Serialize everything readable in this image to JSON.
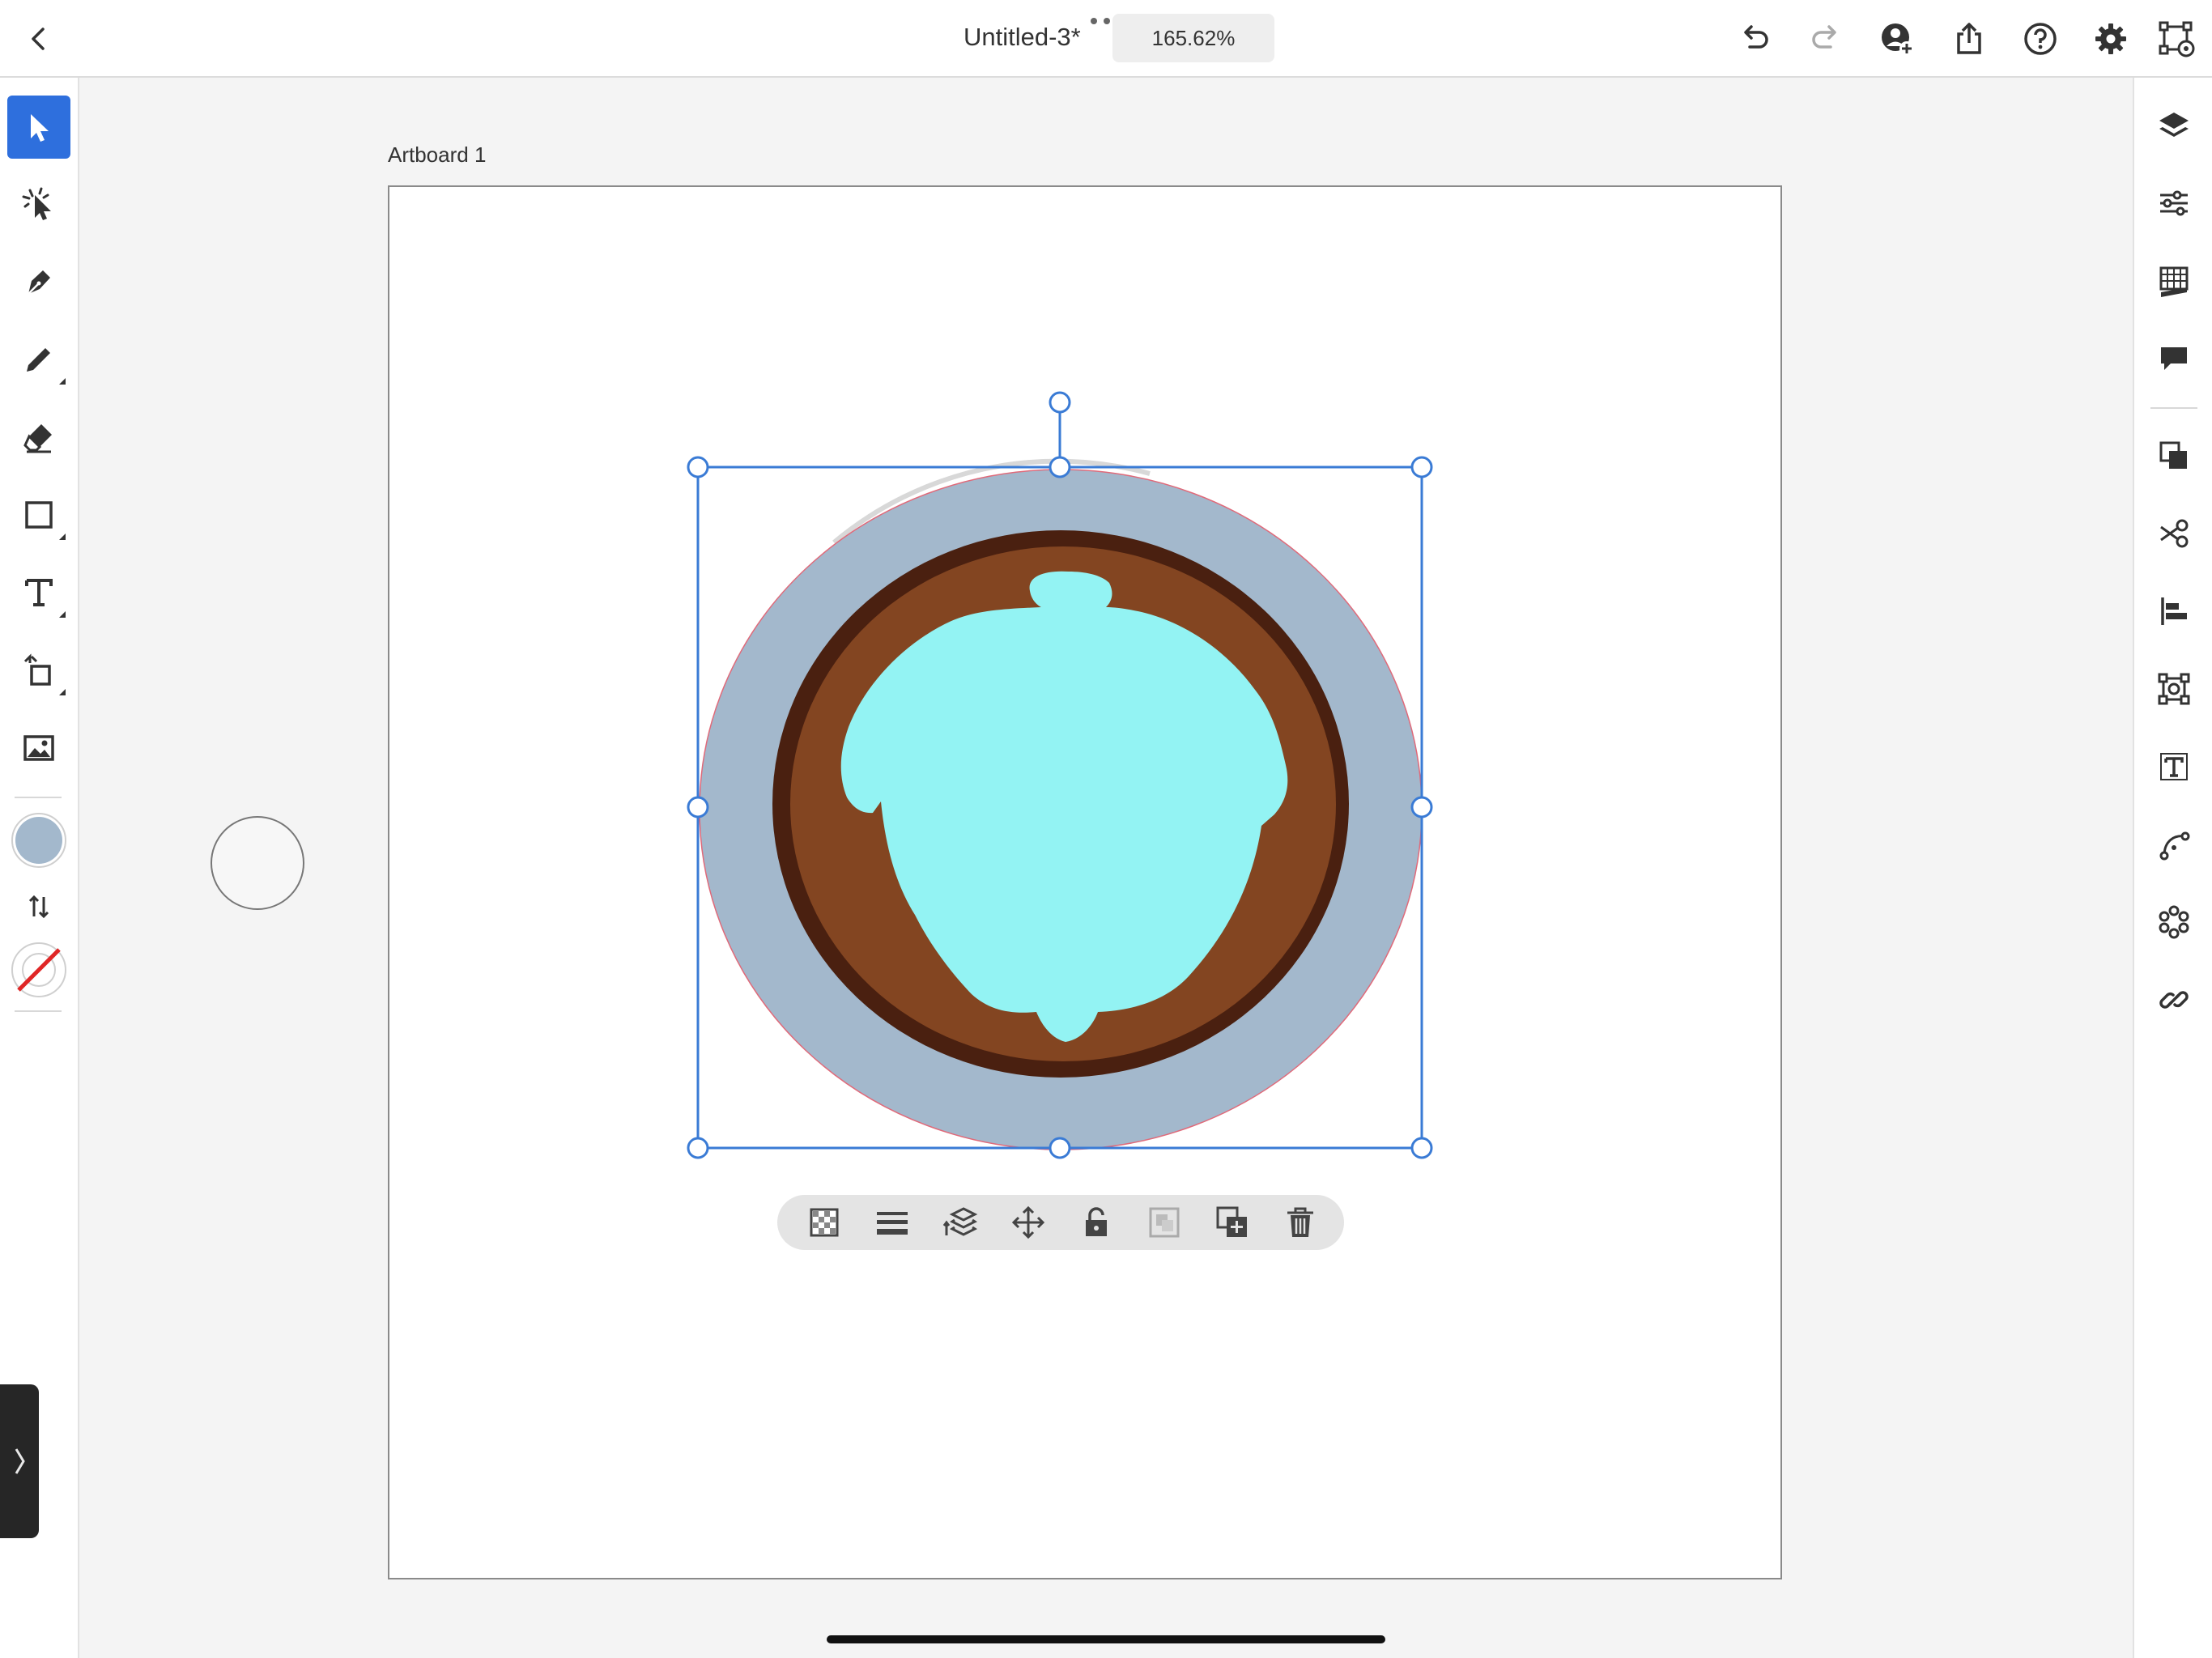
{
  "topbar": {
    "title": "Untitled-3*",
    "zoom": "165.62%",
    "icons": [
      "back-icon",
      "more-icon",
      "undo-icon",
      "redo-icon",
      "invite-icon",
      "share-icon",
      "help-icon",
      "settings-icon",
      "preview-icon"
    ]
  },
  "left_toolbar": {
    "tools": [
      "selection-tool",
      "direct-selection-tool",
      "pen-tool",
      "pencil-tool",
      "eraser-tool",
      "shape-tool",
      "type-tool",
      "transform-tool",
      "image-tool"
    ],
    "active_tool": "selection-tool",
    "fill_color": "#a3b8cc",
    "stroke": "none"
  },
  "right_toolbar": {
    "panels": [
      "layers-icon",
      "properties-icon",
      "libraries-icon",
      "comments-icon",
      "pathfinder-icon",
      "scissors-icon",
      "align-icon",
      "transform-panel-icon",
      "type-panel-icon",
      "path-icon",
      "repeat-icon",
      "links-icon"
    ]
  },
  "canvas": {
    "artboard_label": "Artboard 1",
    "colors": {
      "outer_ring": "#a3b8cc",
      "dark_ring": "#4a2010",
      "brown": "#834521",
      "acorn": "#93f3f3",
      "selection": "#3a7bd5"
    }
  },
  "context_toolbar": {
    "icons": [
      "transparency-icon",
      "stroke-weight-icon",
      "arrange-icon",
      "move-icon",
      "lock-icon",
      "group-icon",
      "duplicate-icon",
      "delete-icon"
    ]
  }
}
